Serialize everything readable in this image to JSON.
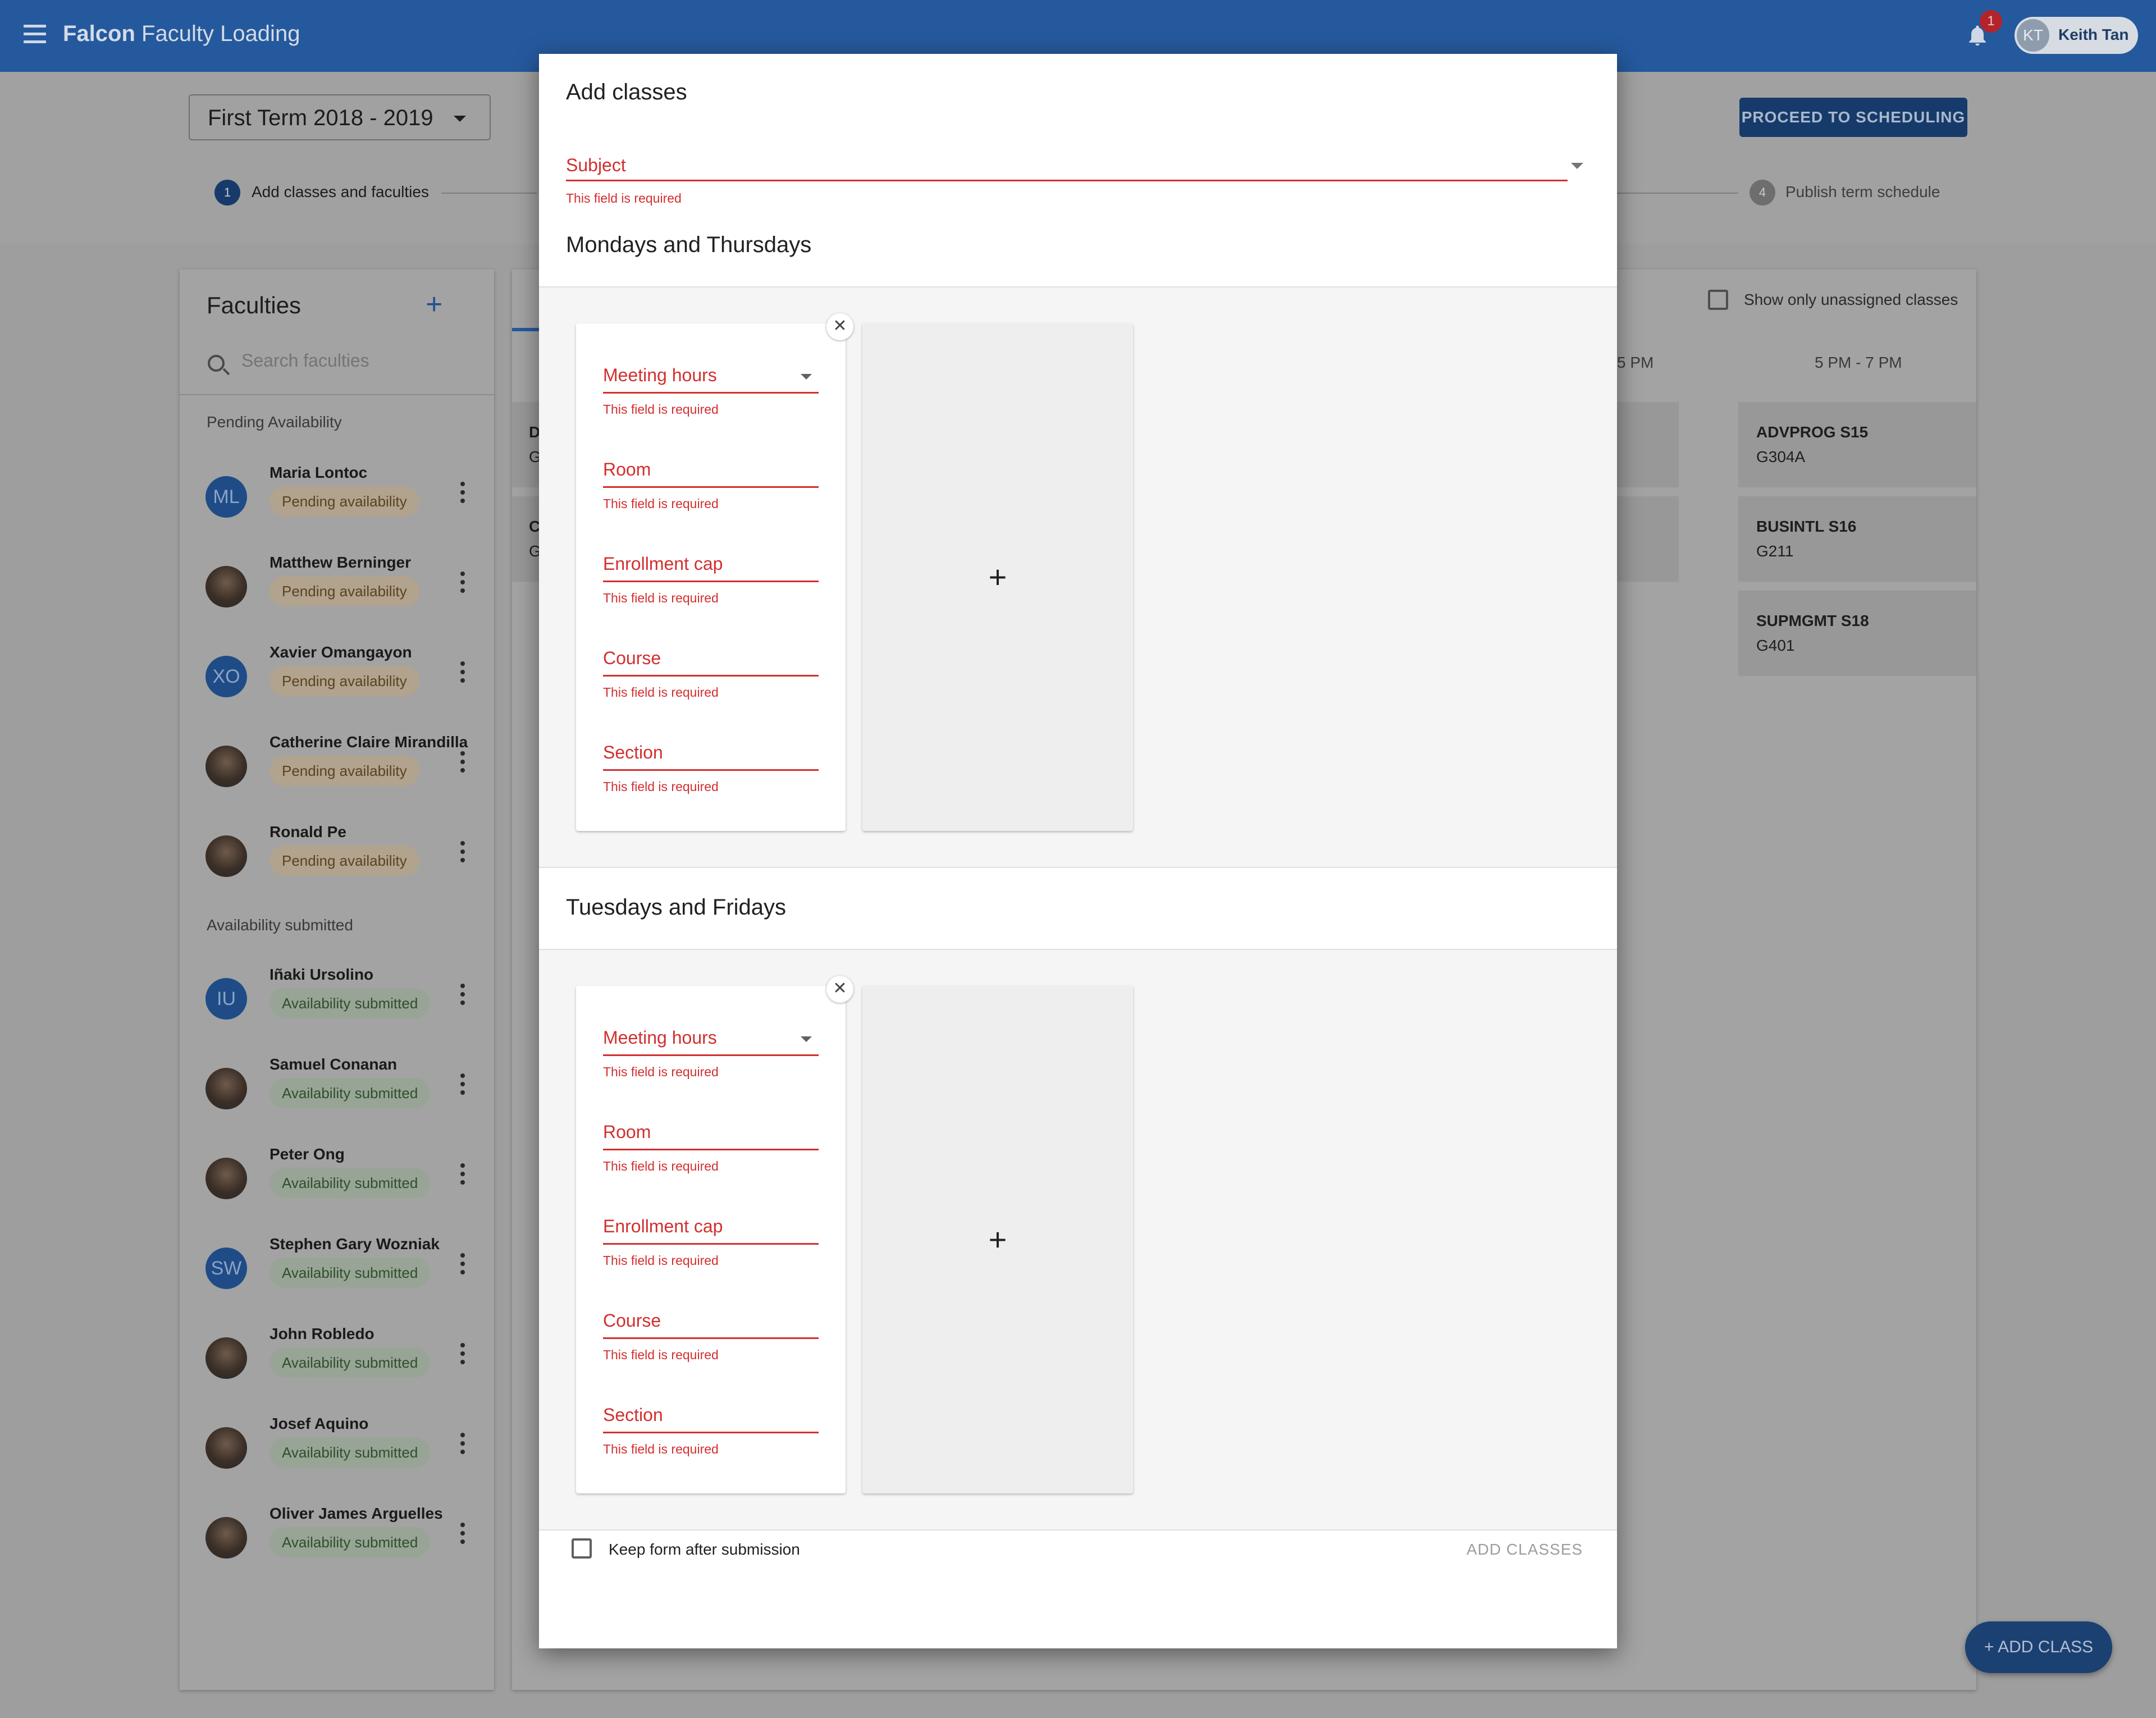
{
  "app": {
    "brand": "Falcon",
    "title": "Faculty Loading",
    "notifications": "1",
    "user": {
      "initials": "KT",
      "name": "Keith Tan"
    }
  },
  "term": {
    "selected": "First Term 2018 - 2019"
  },
  "proceed_button": "PROCEED TO SCHEDULING",
  "steps": [
    {
      "number": "1",
      "label": "Add classes and faculties"
    },
    {
      "number": "4",
      "label": "Publish term schedule"
    }
  ],
  "faculties": {
    "title": "Faculties",
    "search_placeholder": "Search faculties",
    "pending_group": "Pending Availability",
    "submitted_group": "Availability submitted",
    "pending": [
      {
        "name": "Maria Lontoc",
        "initials": "ML",
        "status": "Pending availability"
      },
      {
        "name": "Matthew Berninger",
        "initials": "",
        "status": "Pending availability"
      },
      {
        "name": "Xavier Omangayon",
        "initials": "XO",
        "status": "Pending availability"
      },
      {
        "name": "Catherine Claire Mirandilla",
        "initials": "",
        "status": "Pending availability"
      },
      {
        "name": "Ronald Pe",
        "initials": "",
        "status": "Pending availability"
      }
    ],
    "submitted": [
      {
        "name": "Iñaki Ursolino",
        "initials": "IU",
        "status": "Availability submitted"
      },
      {
        "name": "Samuel Conanan",
        "initials": "",
        "status": "Availability submitted"
      },
      {
        "name": "Peter Ong",
        "initials": "",
        "status": "Availability submitted"
      },
      {
        "name": "Stephen Gary Wozniak",
        "initials": "SW",
        "status": "Availability submitted"
      },
      {
        "name": "John Robledo",
        "initials": "",
        "status": "Availability submitted"
      },
      {
        "name": "Josef Aquino",
        "initials": "",
        "status": "Availability submitted"
      },
      {
        "name": "Oliver James Arguelles",
        "initials": "",
        "status": "Availability submitted"
      }
    ]
  },
  "schedule": {
    "show_unassigned_label": "Show only unassigned classes",
    "col_partial": "5 PM",
    "col_last": "5 PM - 7 PM",
    "left_cells": [
      {
        "code": "D",
        "room": "G"
      },
      {
        "code": "C",
        "room": "G"
      }
    ],
    "cells": [
      {
        "code": "ADVPROG S15",
        "room": "G304A"
      },
      {
        "code": "BUSINTL S16",
        "room": "G211"
      },
      {
        "code": "SUPMGMT S18",
        "room": "G401"
      }
    ]
  },
  "fab_label": "ADD CLASS",
  "modal": {
    "title": "Add classes",
    "subject_label": "Subject",
    "required": "This field is required",
    "sections": [
      {
        "title": "Mondays and Thursdays",
        "fields": [
          "Meeting hours",
          "Room",
          "Enrollment cap",
          "Course",
          "Section"
        ]
      },
      {
        "title": "Tuesdays and Fridays",
        "fields": [
          "Meeting hours",
          "Room",
          "Enrollment cap",
          "Course",
          "Section"
        ]
      }
    ],
    "close_glyph": "✕",
    "add_glyph": "+",
    "keep_form_label": "Keep form after submission",
    "submit_label": "ADD CLASSES"
  }
}
